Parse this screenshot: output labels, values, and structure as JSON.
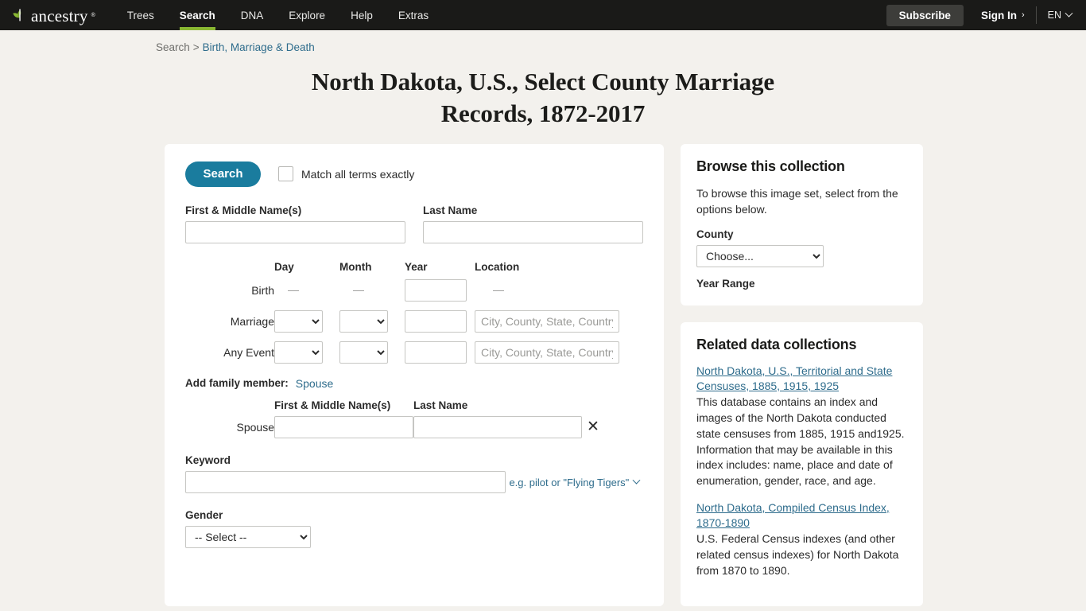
{
  "nav": {
    "brand": "ancestry",
    "brand_tm": "®",
    "items": [
      {
        "label": "Trees",
        "active": false
      },
      {
        "label": "Search",
        "active": true
      },
      {
        "label": "DNA",
        "active": false
      },
      {
        "label": "Explore",
        "active": false
      },
      {
        "label": "Help",
        "active": false
      },
      {
        "label": "Extras",
        "active": false
      }
    ],
    "subscribe_label": "Subscribe",
    "signin_label": "Sign In",
    "signin_chevron": "›",
    "language": "EN",
    "accent_green": "#8ab833",
    "bar_color": "#1a1a18"
  },
  "breadcrumb": {
    "root": "Search",
    "separator": ">",
    "current": "Birth, Marriage & Death"
  },
  "page_title": "North Dakota, U.S., Select County Marriage Records, 1872-2017",
  "search_form": {
    "search_button": "Search",
    "match_exact_label": "Match all terms exactly",
    "match_exact_checked": false,
    "first_name_label": "First & Middle Name(s)",
    "first_name_value": "",
    "last_name_label": "Last Name",
    "last_name_value": "",
    "columns": {
      "day": "Day",
      "month": "Month",
      "year": "Year",
      "location": "Location"
    },
    "location_placeholder": "City, County, State, Country",
    "dash": "—",
    "rows": [
      {
        "name": "Birth",
        "day_type": "dash",
        "month_type": "dash",
        "year_value": "",
        "loc_type": "dash"
      },
      {
        "name": "Marriage",
        "day_type": "select",
        "month_type": "select",
        "year_value": "",
        "loc_type": "input"
      },
      {
        "name": "Any Event",
        "day_type": "select",
        "month_type": "select",
        "year_value": "",
        "loc_type": "input"
      }
    ],
    "add_family_label": "Add family member:",
    "add_family_link": "Spouse",
    "spouse": {
      "row_label": "Spouse",
      "first_name_label": "First & Middle Name(s)",
      "last_name_label": "Last Name",
      "first_name_value": "",
      "last_name_value": "",
      "remove_glyph": "✕"
    },
    "keyword_label": "Keyword",
    "keyword_value": "",
    "keyword_hint": "e.g. pilot or \"Flying Tigers\"",
    "gender_label": "Gender",
    "gender_selected": "-- Select --"
  },
  "browse_panel": {
    "heading": "Browse this collection",
    "intro": "To browse this image set, select from the options below.",
    "county_label": "County",
    "county_selected": "Choose...",
    "year_range_label": "Year Range"
  },
  "related_panel": {
    "heading": "Related data collections",
    "items": [
      {
        "title": "North Dakota, U.S., Territorial and State Censuses, 1885, 1915, 1925",
        "description": "This database contains an index and images of the North Dakota conducted state censuses from 1885, 1915 and1925. Information that may be available in this index includes: name, place and date of enumeration, gender, race, and age."
      },
      {
        "title": "North Dakota, Compiled Census Index, 1870-1890",
        "description": "U.S. Federal Census indexes (and other related census indexes) for North Dakota from 1870 to 1890."
      }
    ]
  },
  "colors": {
    "page_bg": "#f3f1ed",
    "card_bg": "#ffffff",
    "link": "#2e6c8c",
    "primary_button": "#1a7c9e"
  }
}
